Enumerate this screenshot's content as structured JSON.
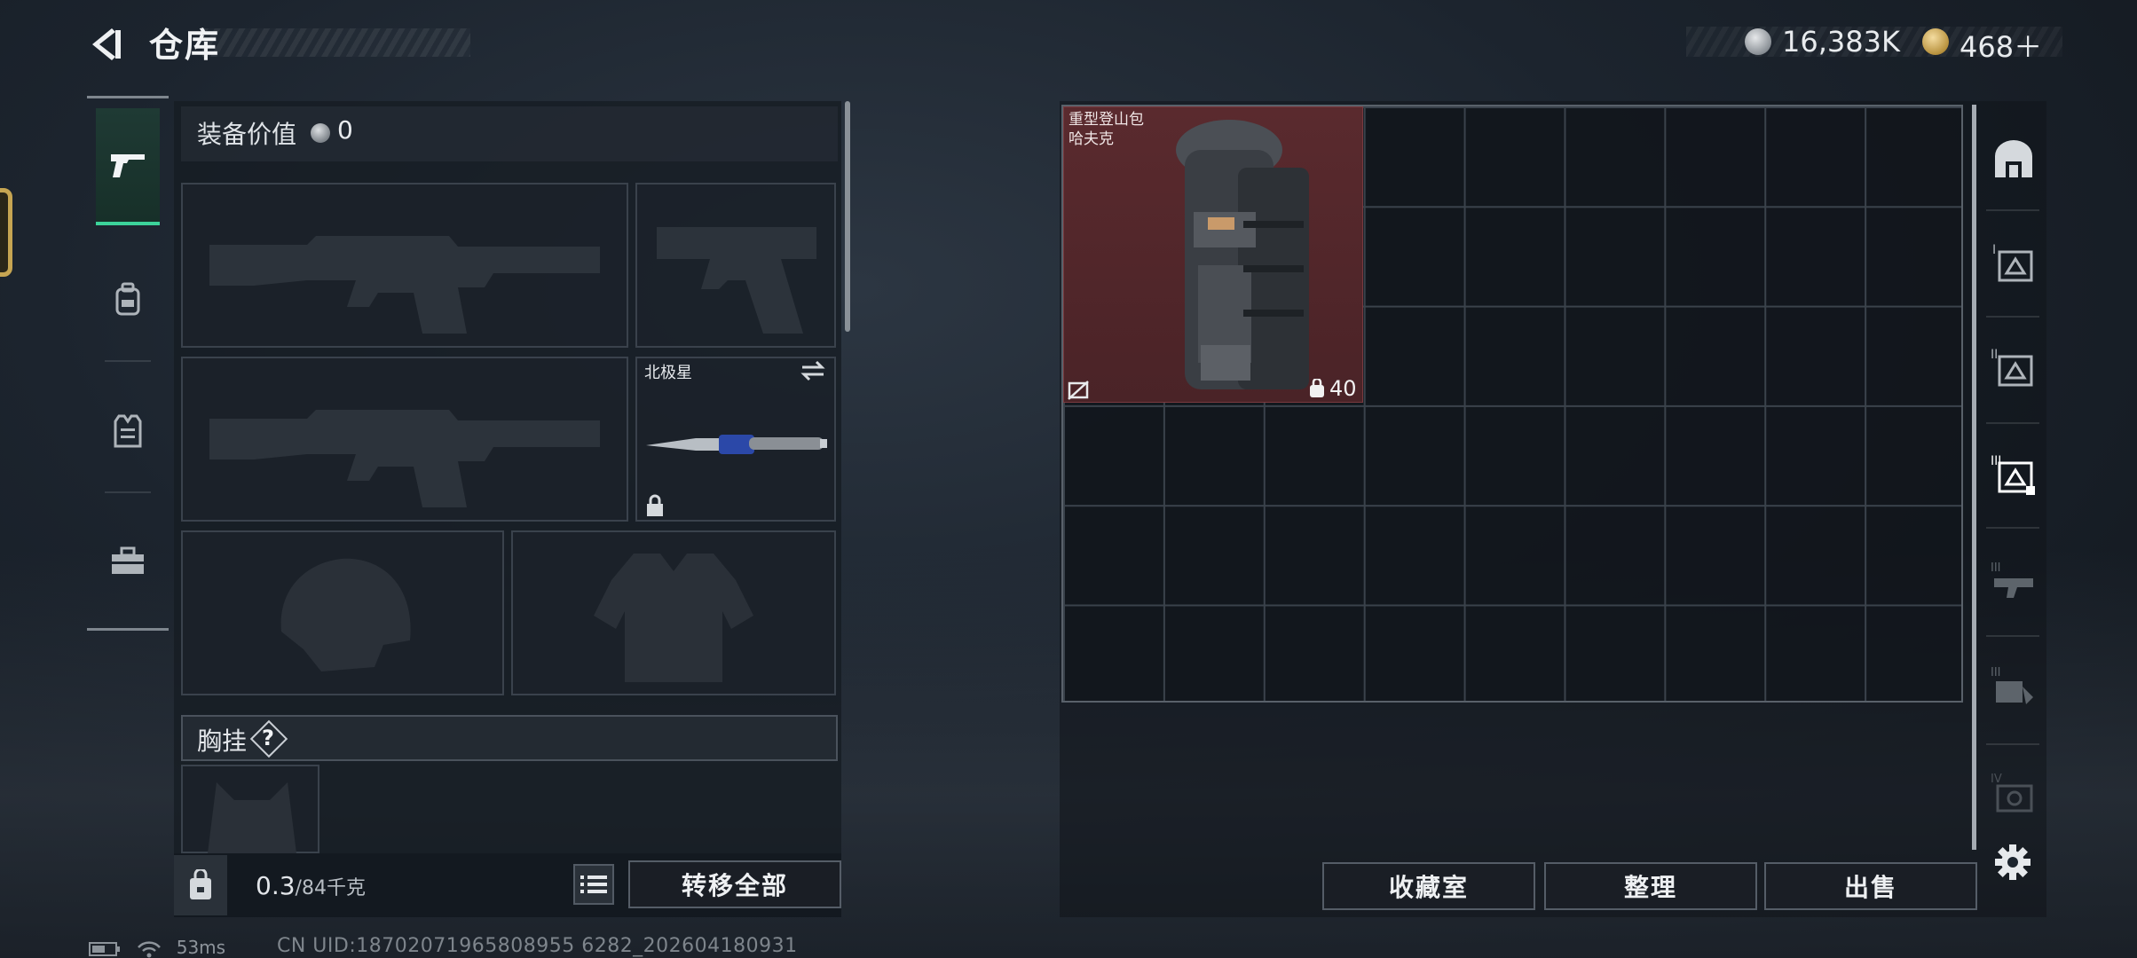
{
  "header": {
    "title": "仓库",
    "currency_silver": "16,383K",
    "currency_gold": "468＋"
  },
  "left_tabs": [
    {
      "name": "weapons",
      "icon": "pistol-icon",
      "active": true
    },
    {
      "name": "backpack",
      "icon": "backpack-icon",
      "active": false
    },
    {
      "name": "armor",
      "icon": "vest-icon",
      "active": false
    },
    {
      "name": "case",
      "icon": "toolbox-icon",
      "active": false
    }
  ],
  "equipment": {
    "value_label": "装备价值",
    "value": "0",
    "knife_name": "北极星",
    "chest_label": "胸挂",
    "chest_help": "?"
  },
  "inventory": {
    "weight_current": "0.3",
    "weight_max": "/84千克",
    "transfer_all": "转移全部"
  },
  "storage": {
    "item_name_line1": "重型登山包",
    "item_name_line2": "哈夫克",
    "item_count": "40",
    "grid_cols": 9,
    "grid_rows": 6
  },
  "actions": {
    "collection": "收藏室",
    "arrange": "整理",
    "sell": "出售"
  },
  "status_bar": {
    "ping": "53ms",
    "uid": "CN UID:18702071965808955 6282_202604180931"
  },
  "colors": {
    "accent_green": "#3cd39a",
    "item_red": "#5a2a2e",
    "gold": "#c6a552"
  }
}
